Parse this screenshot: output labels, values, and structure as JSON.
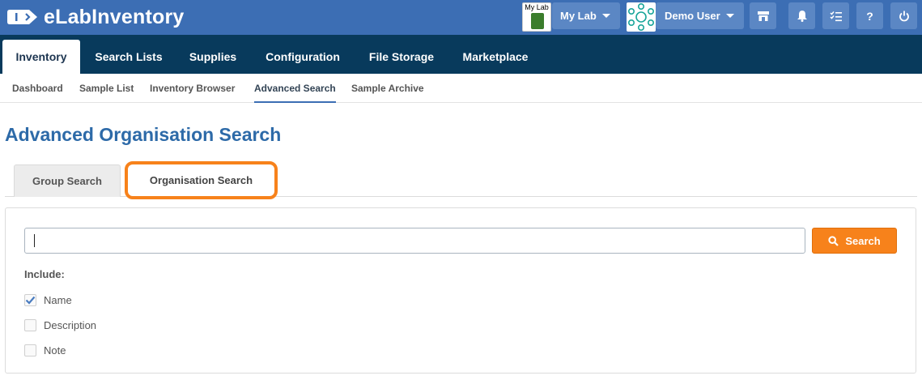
{
  "app": {
    "name": "eLabInventory"
  },
  "header": {
    "lab_badge_label": "My Lab",
    "lab_label": "My Lab",
    "user_label": "Demo User",
    "buttons": [
      "store-icon",
      "bell-icon",
      "checklist-icon",
      "help-icon",
      "power-icon"
    ],
    "help_glyph": "?"
  },
  "main_nav": [
    {
      "label": "Inventory",
      "active": true
    },
    {
      "label": "Search Lists"
    },
    {
      "label": "Supplies"
    },
    {
      "label": "Configuration"
    },
    {
      "label": "File Storage"
    },
    {
      "label": "Marketplace"
    }
  ],
  "sub_nav": [
    {
      "label": "Dashboard"
    },
    {
      "label": "Sample List"
    },
    {
      "label": "Inventory Browser"
    },
    {
      "label": "Advanced Search",
      "active": true
    },
    {
      "label": "Sample Archive"
    }
  ],
  "page": {
    "title": "Advanced Organisation Search",
    "tabs": [
      {
        "label": "Group Search"
      },
      {
        "label": "Organisation Search",
        "active": true,
        "highlighted": true
      }
    ],
    "search": {
      "value": "",
      "button_label": "Search"
    },
    "include": {
      "label": "Include:",
      "options": [
        {
          "label": "Name",
          "checked": true
        },
        {
          "label": "Description",
          "checked": false
        },
        {
          "label": "Note",
          "checked": false
        }
      ]
    }
  },
  "colors": {
    "topbar": "#3c6eb4",
    "main_nav": "#083a5c",
    "accent_orange": "#f7821b",
    "title_blue": "#2d6aa8"
  }
}
